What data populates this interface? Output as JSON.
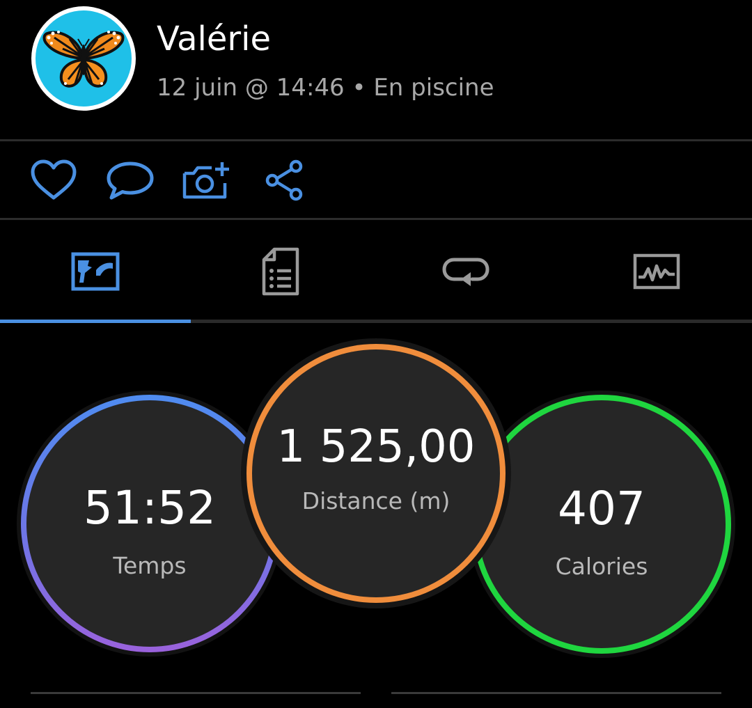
{
  "header": {
    "user_name": "Valérie",
    "activity_meta": "12 juin @ 14:46 • En piscine"
  },
  "actions": [
    {
      "icon": "heart-icon"
    },
    {
      "icon": "comment-icon"
    },
    {
      "icon": "add-photo-icon"
    },
    {
      "icon": "share-icon"
    }
  ],
  "tabs": [
    {
      "icon": "map-icon",
      "active": true
    },
    {
      "icon": "details-document-icon",
      "active": false
    },
    {
      "icon": "laps-loop-icon",
      "active": false
    },
    {
      "icon": "charts-icon",
      "active": false
    }
  ],
  "stats": {
    "time": {
      "value": "51:52",
      "label": "Temps"
    },
    "distance": {
      "value": "1 525,00",
      "label": "Distance (m)"
    },
    "calories": {
      "value": "407",
      "label": "Calories"
    }
  },
  "colors": {
    "accent": "#4a90e2",
    "time_ring_start": "#4f8cf0",
    "time_ring_end": "#9a62dc",
    "distance_ring": "#f08d3c",
    "calories_ring": "#1fd63f",
    "avatar_bg": "#1fc0e8"
  }
}
